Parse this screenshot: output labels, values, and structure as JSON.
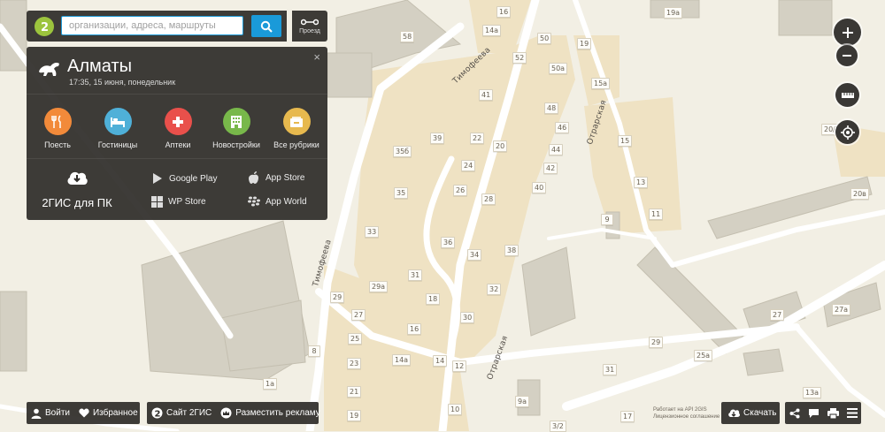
{
  "search": {
    "placeholder": "организации, адреса, маршруты",
    "route_label": "Проезд"
  },
  "city": {
    "name": "Алматы",
    "datetime": "17:35, 15 июня, понедельник",
    "close": "×"
  },
  "rubrics": [
    {
      "label": "Поесть",
      "color": "#f28a3a",
      "icon": "fork-knife-icon"
    },
    {
      "label": "Гостиницы",
      "color": "#4fb0d8",
      "icon": "bed-icon"
    },
    {
      "label": "Аптеки",
      "color": "#e9504b",
      "icon": "cross-icon"
    },
    {
      "label": "Новостройки",
      "color": "#78b84a",
      "icon": "building-icon"
    },
    {
      "label": "Все рубрики",
      "color": "#e7b94e",
      "icon": "folder-icon"
    }
  ],
  "downloads": {
    "pc_label": "2ГИС для ПК",
    "google_play": "Google Play",
    "app_store": "App Store",
    "wp_store": "WP Store",
    "app_world": "App World"
  },
  "map_labels": {
    "streets": [
      "Тимофеева",
      "Тимофеева",
      "Отрарская",
      "Отрарская"
    ],
    "houses": [
      "16",
      "14а",
      "50",
      "19",
      "19а",
      "58",
      "52",
      "50а",
      "15а",
      "41",
      "48",
      "46",
      "44",
      "42",
      "40",
      "39",
      "35б",
      "22",
      "20",
      "24",
      "26",
      "28",
      "35",
      "15",
      "13",
      "11",
      "9",
      "20/1",
      "20в",
      "33",
      "36",
      "34",
      "38",
      "31",
      "29а",
      "32",
      "18",
      "29",
      "27",
      "16",
      "30",
      "25",
      "8",
      "23",
      "21",
      "19",
      "14а",
      "14",
      "12",
      "10",
      "27",
      "27а",
      "29",
      "25а",
      "31",
      "13а",
      "9а",
      "17",
      "3/2",
      "1а"
    ]
  },
  "copyright": {
    "line1": "Работает на API 2GIS",
    "line2": "Лицензионное соглашение"
  },
  "bottom_left": {
    "login": "Войти",
    "favorites": "Избранное"
  },
  "bottom_mid": {
    "site": "Сайт 2ГИС",
    "ads": "Разместить рекламу"
  },
  "bottom_right": {
    "download": "Скачать"
  },
  "colors": {
    "accent": "#1a9ad9",
    "panel": "#2f2d2a",
    "logo": "#9cc43d",
    "map_bg": "#f2efe4",
    "block": "#efe2c3"
  }
}
